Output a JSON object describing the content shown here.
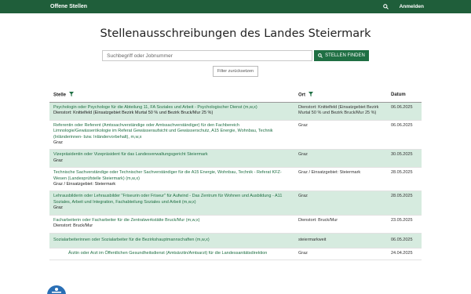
{
  "nav": {
    "brand": "Offene Stellen",
    "login": "Anmelden"
  },
  "page": {
    "title": "Stellenausschreibungen des Landes Steiermark"
  },
  "search": {
    "placeholder": "Suchbegriff oder Jobnummer",
    "button": "STELLEN FINDEN",
    "reset": "Filter zurücksetzen"
  },
  "table": {
    "headers": {
      "stelle": "Stelle",
      "ort": "Ort",
      "datum": "Datum"
    },
    "rows": [
      {
        "title": "Psychologin oder Psychologe für die Abteilung 11, FA Soziales und Arbeit - Psychologischer Dienst (m,w,x)",
        "location_line": "Dienstort: Knittelfeld (Einsatzgebiet Bezirk Murtal 50 % und Bezirk Bruck/Mur 25 %)",
        "ort": "Dienstort: Knittelfeld (Einsatzgebiet Bezirk Murtal 50 % und Bezirk Bruck/Mur 25 %)",
        "datum": "06.06.2025"
      },
      {
        "title": "Referentin oder Referent (Amtssachverständige oder Amtssachverständiger) für den Fachbereich Limnologie/Gewässerökologie im Referat Gewässeraufsicht und Gewässerschutz, A15 Energie, Wohnbau, Technik (Inländerinnen- bzw. Inländervorbehalt), m,w,x",
        "location_line": "Graz",
        "ort": "Graz",
        "datum": "06.06.2025"
      },
      {
        "title": "Vizepräsidentin oder Vizepräsident für das Landesverwaltungsgericht Steiermark",
        "location_line": "Graz",
        "ort": "Graz",
        "datum": "30.05.2025"
      },
      {
        "title": "Technische Sachverständige oder Technischer Sachverständiger für die A15 Energie, Wohnbau, Technik - Referat KFZ-Wesen (Landesprüfstelle Steiermark) (m,w,x)",
        "location_line": "Graz / Einsatzgebiet: Steiermark",
        "ort": "Graz / Einsatzgebiet: Steiermark",
        "datum": "28.05.2025"
      },
      {
        "title": "Lehrausbilderin oder Lehrausbilder \"Friseurin oder Friseur\" für Aufwind - Das Zentrum für Wohnen und Ausbildung - A11 Soziales, Arbeit und Integration, Fachabteilung Soziales und Arbeit (m,w,x)",
        "location_line": "Graz",
        "ort": "Graz",
        "datum": "28.05.2025"
      },
      {
        "title": "Facharbeiterin oder Facharbeiter für die Zentralwerkstätte Bruck/Mur (m,w,x)",
        "location_line": "Dienstort: Bruck/Mur",
        "ort": "Dienstort: Bruck/Mur",
        "datum": "23.05.2025"
      },
      {
        "title": "Sozialarbeiterinnen oder Sozialarbeiter für die Bezirkshauptmannschaften (m,w,x)",
        "location_line": "",
        "ort": "steiermarkweit",
        "datum": "06.05.2025"
      },
      {
        "title": "Ärztin oder Arzt im Öffentlichen Gesundheitsdienst (Amtsärztin/Amtsarzt) für die Landessanitätsdirektion",
        "location_line": "",
        "ort": "Graz",
        "datum": "24.04.2025"
      }
    ]
  },
  "colors": {
    "nav_bg": "#1f5e3a",
    "accent": "#1f6f43",
    "row_alt": "#d6ebdf"
  },
  "icons": {
    "nav_search": "search-icon",
    "button_search": "search-icon",
    "filter": "filter-icon",
    "avatar": "accessibility-icon"
  }
}
